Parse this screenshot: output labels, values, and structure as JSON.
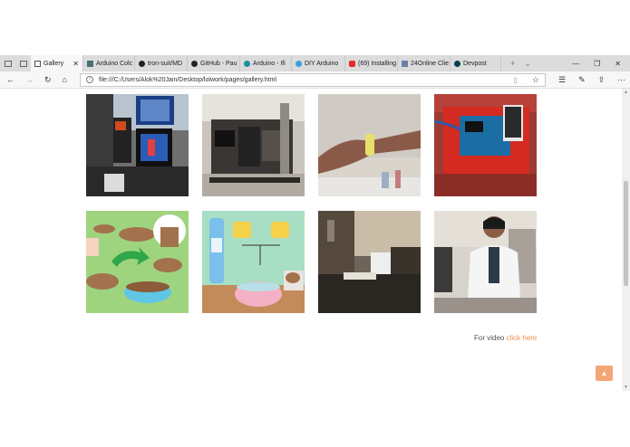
{
  "tabs": [
    {
      "label": "Gallery",
      "active": true,
      "icon": "page-icon"
    },
    {
      "label": "Arduino Colc",
      "icon": "arduino-icon"
    },
    {
      "label": "tron-suit/MD",
      "icon": "github-icon"
    },
    {
      "label": "GitHub - Pau",
      "icon": "github-icon"
    },
    {
      "label": "Arduino - Ifi",
      "icon": "arduino-icon"
    },
    {
      "label": "DIY Arduino",
      "icon": "globe-icon"
    },
    {
      "label": "(69) Installing",
      "icon": "youtube-icon"
    },
    {
      "label": "24Online Clie",
      "icon": "network-icon"
    },
    {
      "label": "Devpost",
      "icon": "devpost-icon"
    }
  ],
  "address": {
    "url": "file:///C:/Users/Alok%20Jain/Desktop/lolwork/pages/gallery.html"
  },
  "gallery": {
    "row1": [
      "lab equipment photo",
      "machine photo",
      "hand holding tube photo",
      "arduino board photo"
    ],
    "row2": [
      "soil illustration",
      "bottle and cups illustration",
      "lab room photo",
      "person in lab coat photo"
    ]
  },
  "footer": {
    "text": "For video",
    "link": "click here"
  },
  "colors": {
    "accent": "#f0914a",
    "totop": "#f4a578"
  }
}
